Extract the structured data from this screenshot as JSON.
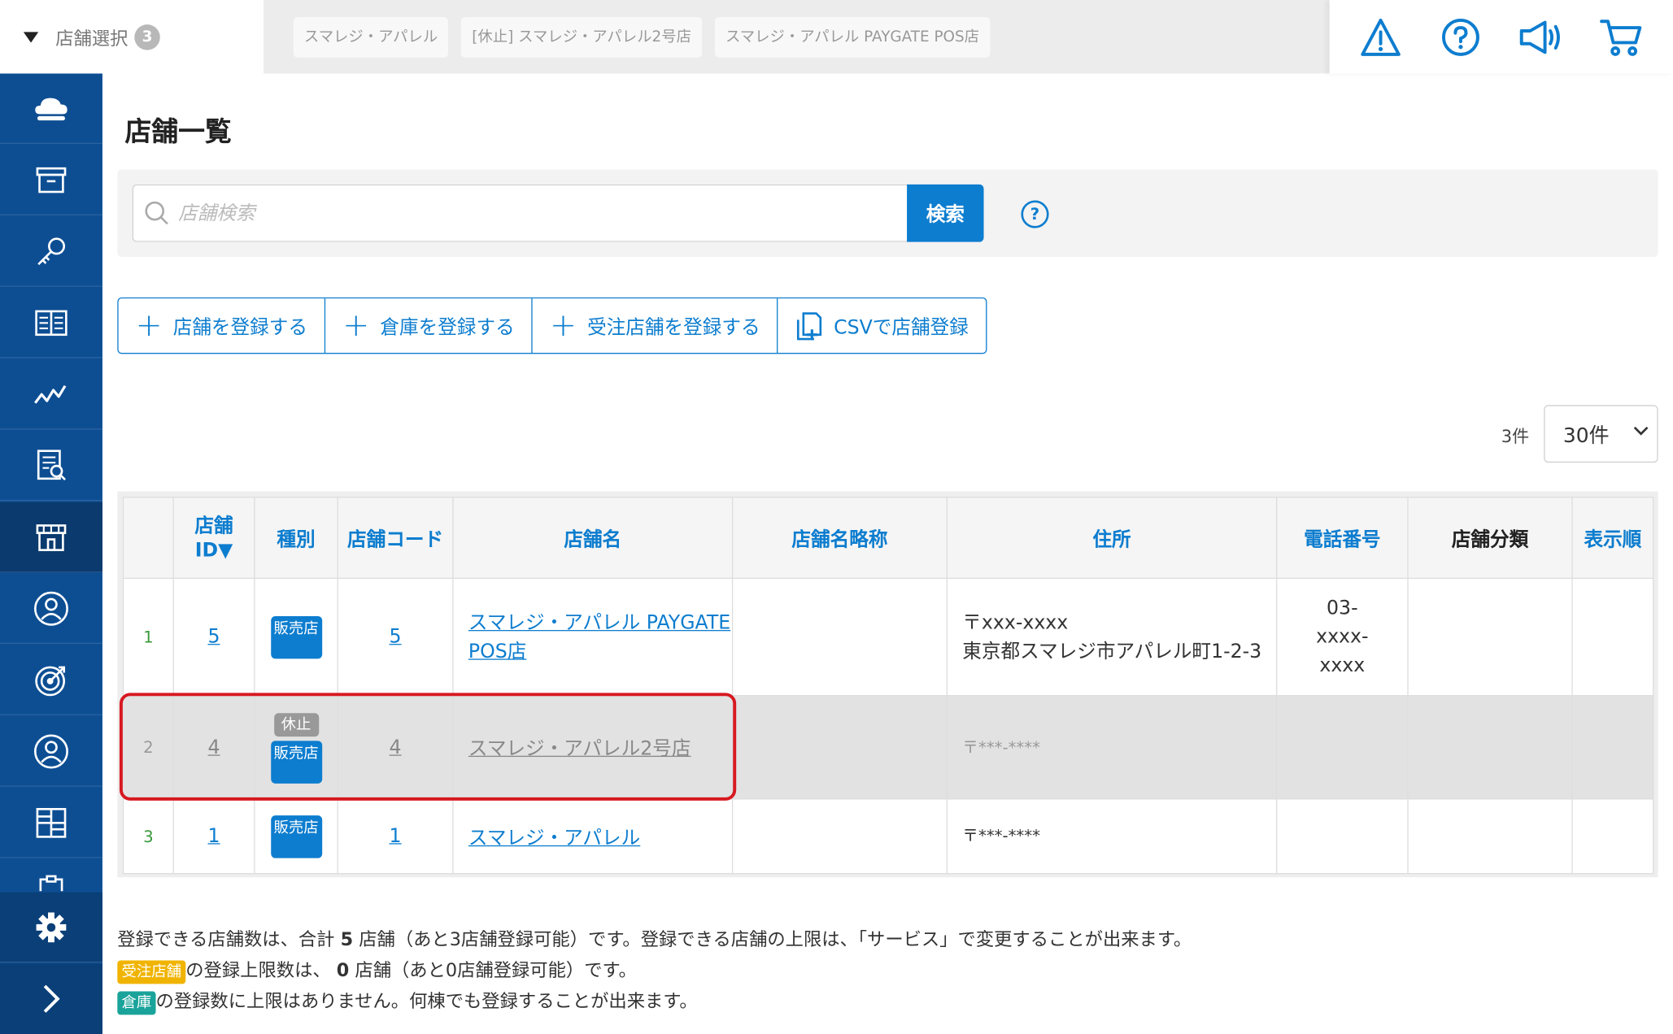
{
  "topbar": {
    "store_select_label": "店舗選択",
    "store_select_count": "3",
    "tabs": [
      "スマレジ・アパレル",
      "[休止] スマレジ・アパレル2号店",
      "スマレジ・アパレル PAYGATE POS店"
    ],
    "icons": [
      "warning-icon",
      "help-icon",
      "megaphone-icon",
      "cart-icon"
    ]
  },
  "sidebar": {
    "items": [
      "cloud-icon",
      "archive-icon",
      "key-icon",
      "book-icon",
      "chart-icon",
      "report-icon",
      "store-icon",
      "customer-icon",
      "target-icon",
      "user-icon",
      "grid-icon",
      "clipboard-icon"
    ],
    "active": "store-icon",
    "bottom": [
      "gear-icon",
      "chevron-right-icon"
    ]
  },
  "page": {
    "title": "店舗一覧"
  },
  "search": {
    "placeholder": "店舗検索",
    "button": "検索",
    "help": "?"
  },
  "actions": {
    "add_store": "店舗を登録する",
    "add_warehouse": "倉庫を登録する",
    "add_order_store": "受注店舗を登録する",
    "csv_register": "CSVで店舗登録"
  },
  "pager": {
    "count": "3件",
    "per_page": "30件"
  },
  "table": {
    "headers": {
      "store_id": "店舗ID▼",
      "type": "種別",
      "store_code": "店舗コード",
      "store_name": "店舗名",
      "short_name": "店舗名略称",
      "address": "住所",
      "phone": "電話番号",
      "category": "店舗分類",
      "order": "表示順"
    },
    "rows": [
      {
        "no": "1",
        "id": "5",
        "type": "販売店",
        "paused": "",
        "code": "5",
        "name": "スマレジ・アパレル PAYGATE POS店",
        "short": "",
        "zip": "〒xxx-xxxx",
        "address": "東京都スマレジ市アパレル町1-2-3",
        "phone": "03-xxxx-xxxx",
        "category": "",
        "order": ""
      },
      {
        "no": "2",
        "id": "4",
        "type": "販売店",
        "paused": "休止",
        "code": "4",
        "name": "スマレジ・アパレル2号店",
        "short": "",
        "zip": "〒***-****",
        "address": "",
        "phone": "",
        "category": "",
        "order": ""
      },
      {
        "no": "3",
        "id": "1",
        "type": "販売店",
        "paused": "",
        "code": "1",
        "name": "スマレジ・アパレル",
        "short": "",
        "zip": "〒***-****",
        "address": "",
        "phone": "",
        "category": "",
        "order": ""
      }
    ]
  },
  "notes": {
    "line1_a": "登録できる店舗数は、合計",
    "line1_num": "5",
    "line1_b": "店舗（あと3店舗登録可能）です。登録できる店舗の上限は、「サービス」で変更することが出来ます。",
    "tag_order": "受注店舗",
    "line2_a": "の登録上限数は、",
    "line2_num": "0",
    "line2_b": "店舗（あと0店舗登録可能）です。",
    "tag_wh": "倉庫",
    "line3": "の登録数に上限はありません。何棟でも登録することが出来ます。"
  },
  "colors": {
    "brand": "#0d4e93",
    "accent": "#0d7dcf",
    "highlight": "#d71920",
    "order_tag": "#f0b400",
    "warehouse_tag": "#1aa39a"
  }
}
